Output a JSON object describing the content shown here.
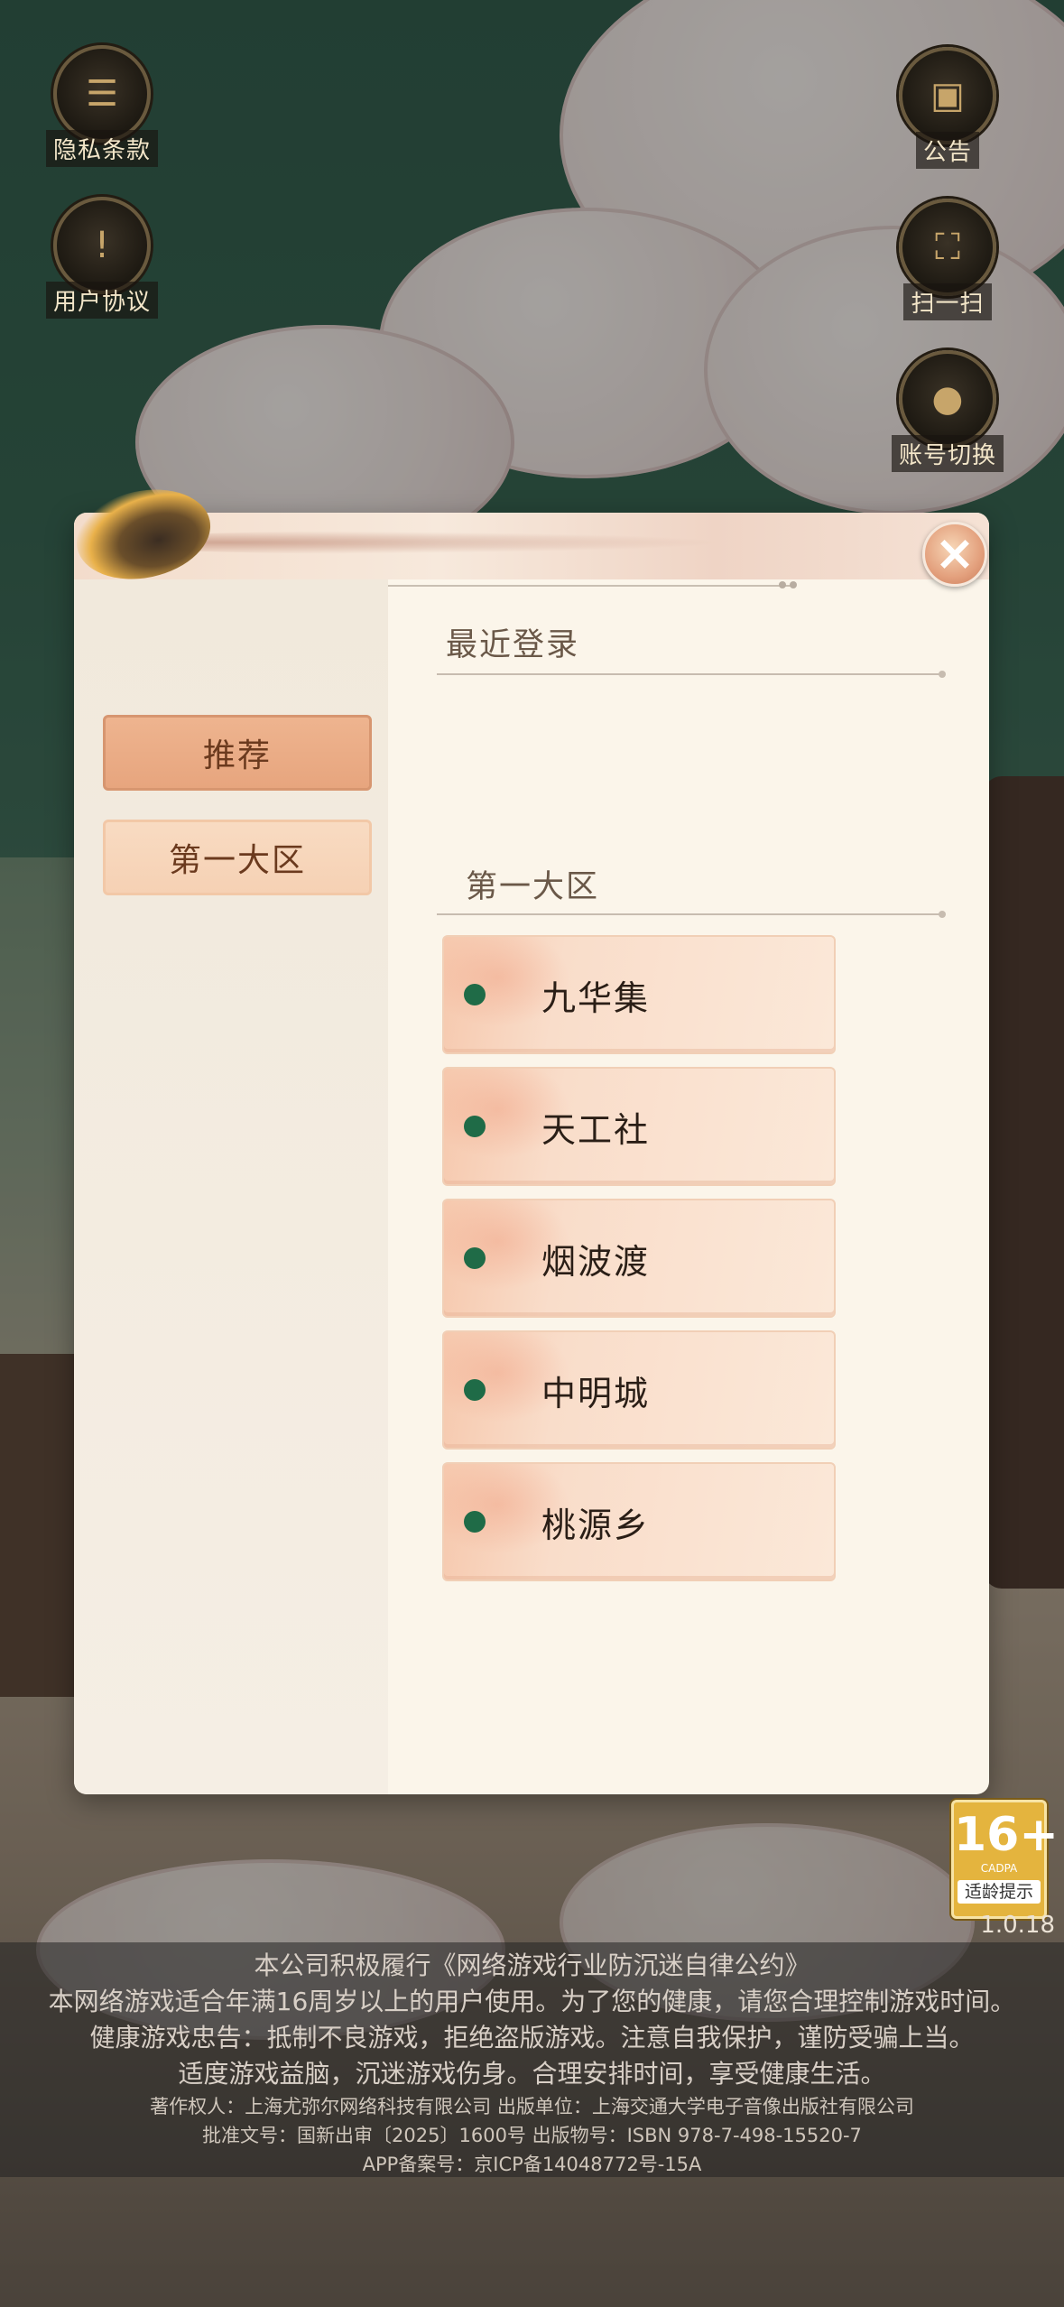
{
  "side_buttons": {
    "privacy": "隐私条款",
    "user_agreement": "用户协议",
    "announcement": "公告",
    "scan": "扫一扫",
    "switch_account": "账号切换"
  },
  "icons": {
    "privacy": "scroll-list-icon",
    "user_agreement": "exclamation-book-icon",
    "announcement": "scroll-icon",
    "scan": "scan-frame-icon",
    "switch_account": "user-icon",
    "close": "close-icon"
  },
  "sidebar": {
    "items": [
      {
        "label": "推荐",
        "active": true
      },
      {
        "label": "第一大区",
        "active": false
      }
    ]
  },
  "main": {
    "recent_title": "最近登录",
    "region_title": "第一大区",
    "servers": [
      {
        "name": "九华集",
        "status_color": "#1f6b47"
      },
      {
        "name": "天工社",
        "status_color": "#1f6b47"
      },
      {
        "name": "烟波渡",
        "status_color": "#1f6b47"
      },
      {
        "name": "中明城",
        "status_color": "#1f6b47"
      },
      {
        "name": "桃源乡",
        "status_color": "#1f6b47"
      }
    ]
  },
  "age_rating": {
    "number": "16+",
    "org": "CADPA",
    "tip": "适龄提示"
  },
  "version": "1.0.18",
  "notice": {
    "line1": "本公司积极履行《网络游戏行业防沉迷自律公约》",
    "line2": "本网络游戏适合年满16周岁以上的用户使用。为了您的健康，请您合理控制游戏时间。",
    "line3": "健康游戏忠告：抵制不良游戏，拒绝盗版游戏。注意自我保护，谨防受骗上当。",
    "line4": "适度游戏益脑，沉迷游戏伤身。合理安排时间，享受健康生活。",
    "line5": "著作权人：上海尤弥尔网络科技有限公司  出版单位：上海交通大学电子音像出版社有限公司",
    "line6": "批准文号：国新出审〔2025〕1600号  出版物号：ISBN 978-7-498-15520-7",
    "line7": "APP备案号：京ICP备14048772号-15A"
  },
  "colors": {
    "accent": "#e7a57e",
    "status_online": "#1f6b47",
    "dialog_bg": "#fbf5ea"
  }
}
